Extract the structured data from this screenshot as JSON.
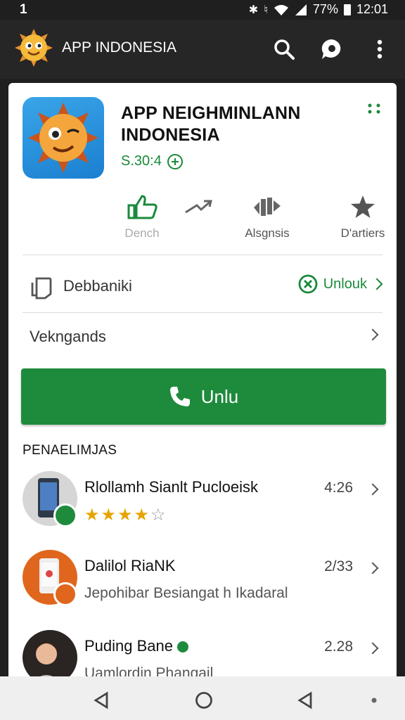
{
  "status_bar": {
    "left": "1",
    "battery": "77%",
    "time": "12:01"
  },
  "app_bar": {
    "title": "APP INDONESIA",
    "search_icon": "search-icon",
    "chat_icon": "chat-icon",
    "menu_icon": "more-vert-icon"
  },
  "app": {
    "name": "APP NEIGHMINLANN INDONESIA",
    "price": "S.30:4"
  },
  "stats": [
    {
      "label": "Dench",
      "icon": "thumbs-up-icon"
    },
    {
      "label": "",
      "icon": "send-icon"
    },
    {
      "label": "Alsgnsis",
      "icon": "stack-icon"
    },
    {
      "label": "D'artiers",
      "icon": "star-icon"
    }
  ],
  "rows": {
    "details_label": "Debbaniki",
    "details_action": "Unlouk",
    "versions_label": "Vekngands"
  },
  "cta": {
    "label": "Unlu"
  },
  "section_title": "PENAELIMJAS",
  "list": [
    {
      "title": "Rlollamh Sianlt Pucloeisk",
      "value": "4:26",
      "rating": 4,
      "rating_max": 5
    },
    {
      "title": "Dalilol RiaNK",
      "subtitle": "Jepohibar Besiangat h Ikadaral",
      "value": "2/33"
    },
    {
      "title": "Puding Bane",
      "subtitle": "Uamlordin Phangail",
      "value": "2.28"
    }
  ],
  "colors": {
    "accent": "#1e8b3c",
    "star": "#e6a400",
    "app_bar": "#262626"
  }
}
